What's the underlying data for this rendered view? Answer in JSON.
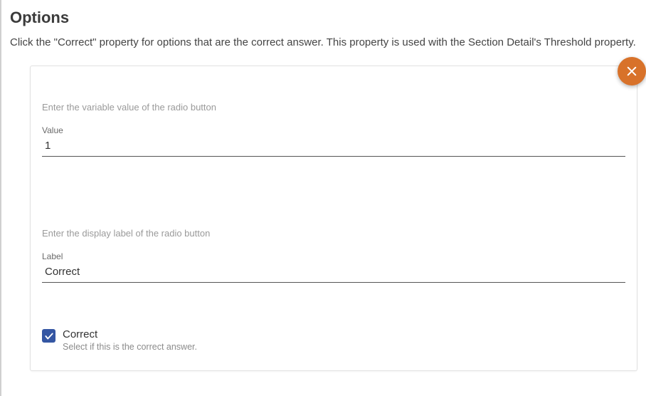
{
  "title": "Options",
  "description": "Click the \"Correct\" property for options that are the correct answer. This property is used with the Section Detail's Threshold property.",
  "card": {
    "value_field": {
      "hint": "Enter the variable value of the radio button",
      "label": "Value",
      "value": "1"
    },
    "label_field": {
      "hint": "Enter the display label of the radio button",
      "label": "Label",
      "value": "Correct"
    },
    "correct": {
      "label": "Correct",
      "help": "Select if this is the correct answer.",
      "checked": true
    }
  }
}
